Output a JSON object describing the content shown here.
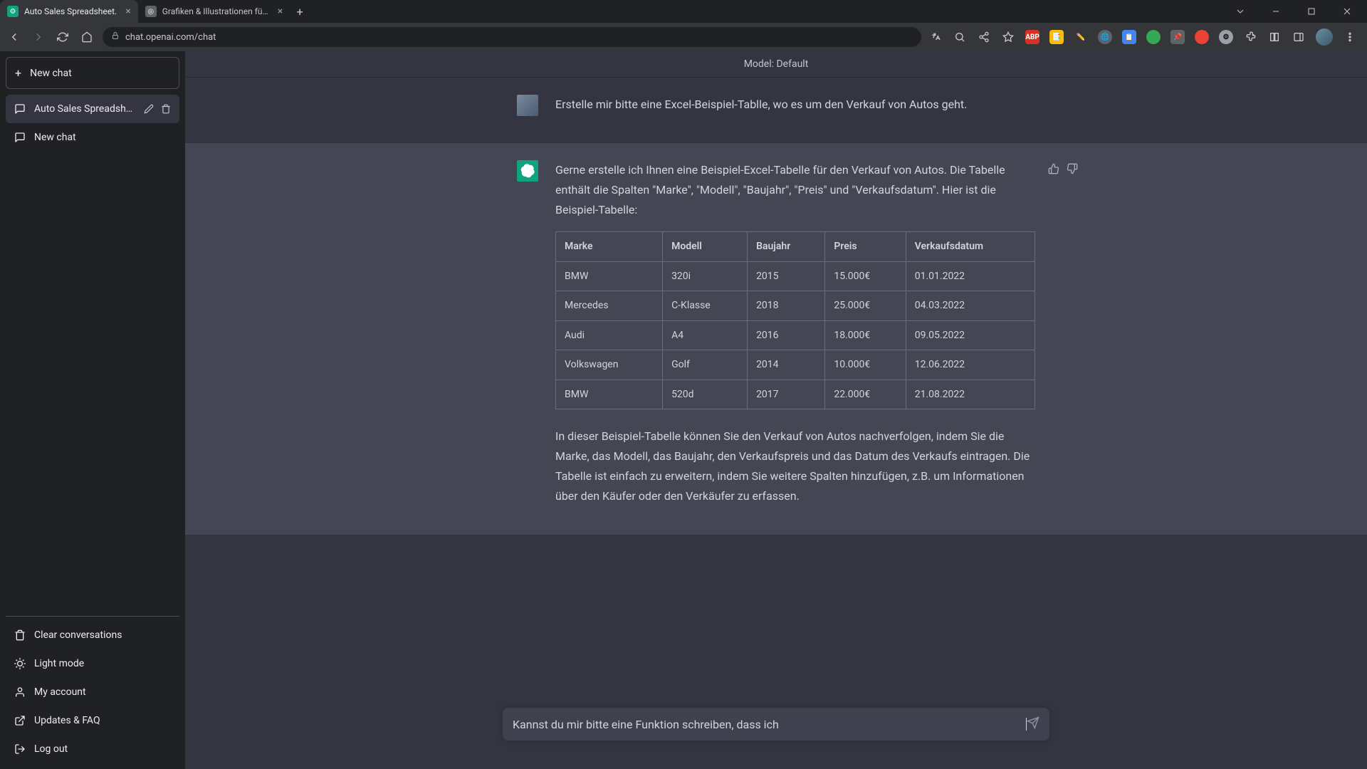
{
  "browser": {
    "tabs": [
      {
        "title": "Auto Sales Spreadsheet.",
        "active": true
      },
      {
        "title": "Grafiken & Illustrationen für Vek",
        "active": false
      }
    ],
    "url": "chat.openai.com/chat"
  },
  "sidebar": {
    "new_chat": "New chat",
    "conversations": [
      {
        "title": "Auto Sales Spreadshee",
        "active": true
      },
      {
        "title": "New chat",
        "active": false
      }
    ],
    "footer": {
      "clear": "Clear conversations",
      "light_mode": "Light mode",
      "account": "My account",
      "updates": "Updates & FAQ",
      "logout": "Log out"
    }
  },
  "header": {
    "model_label": "Model: Default"
  },
  "messages": {
    "user1": "Erstelle mir bitte eine Excel-Beispiel-Tablle, wo es um den Verkauf von Autos geht.",
    "assistant_intro": "Gerne erstelle ich Ihnen eine Beispiel-Excel-Tabelle für den Verkauf von Autos. Die Tabelle enthält die Spalten \"Marke\", \"Modell\", \"Baujahr\", \"Preis\" und \"Verkaufsdatum\". Hier ist die Beispiel-Tabelle:",
    "assistant_outro": "In dieser Beispiel-Tabelle können Sie den Verkauf von Autos nachverfolgen, indem Sie die Marke, das Modell, das Baujahr, den Verkaufspreis und das Datum des Verkaufs eintragen. Die Tabelle ist einfach zu erweitern, indem Sie weitere Spalten hinzufügen, z.B. um Informationen über den Käufer oder den Verkäufer zu erfassen."
  },
  "table": {
    "headers": [
      "Marke",
      "Modell",
      "Baujahr",
      "Preis",
      "Verkaufsdatum"
    ],
    "rows": [
      [
        "BMW",
        "320i",
        "2015",
        "15.000€",
        "01.01.2022"
      ],
      [
        "Mercedes",
        "C-Klasse",
        "2018",
        "25.000€",
        "04.03.2022"
      ],
      [
        "Audi",
        "A4",
        "2016",
        "18.000€",
        "09.05.2022"
      ],
      [
        "Volkswagen",
        "Golf",
        "2014",
        "10.000€",
        "12.06.2022"
      ],
      [
        "BMW",
        "520d",
        "2017",
        "22.000€",
        "21.08.2022"
      ]
    ]
  },
  "input": {
    "value": "Kannst du mir bitte eine Funktion schreiben, dass ich "
  }
}
